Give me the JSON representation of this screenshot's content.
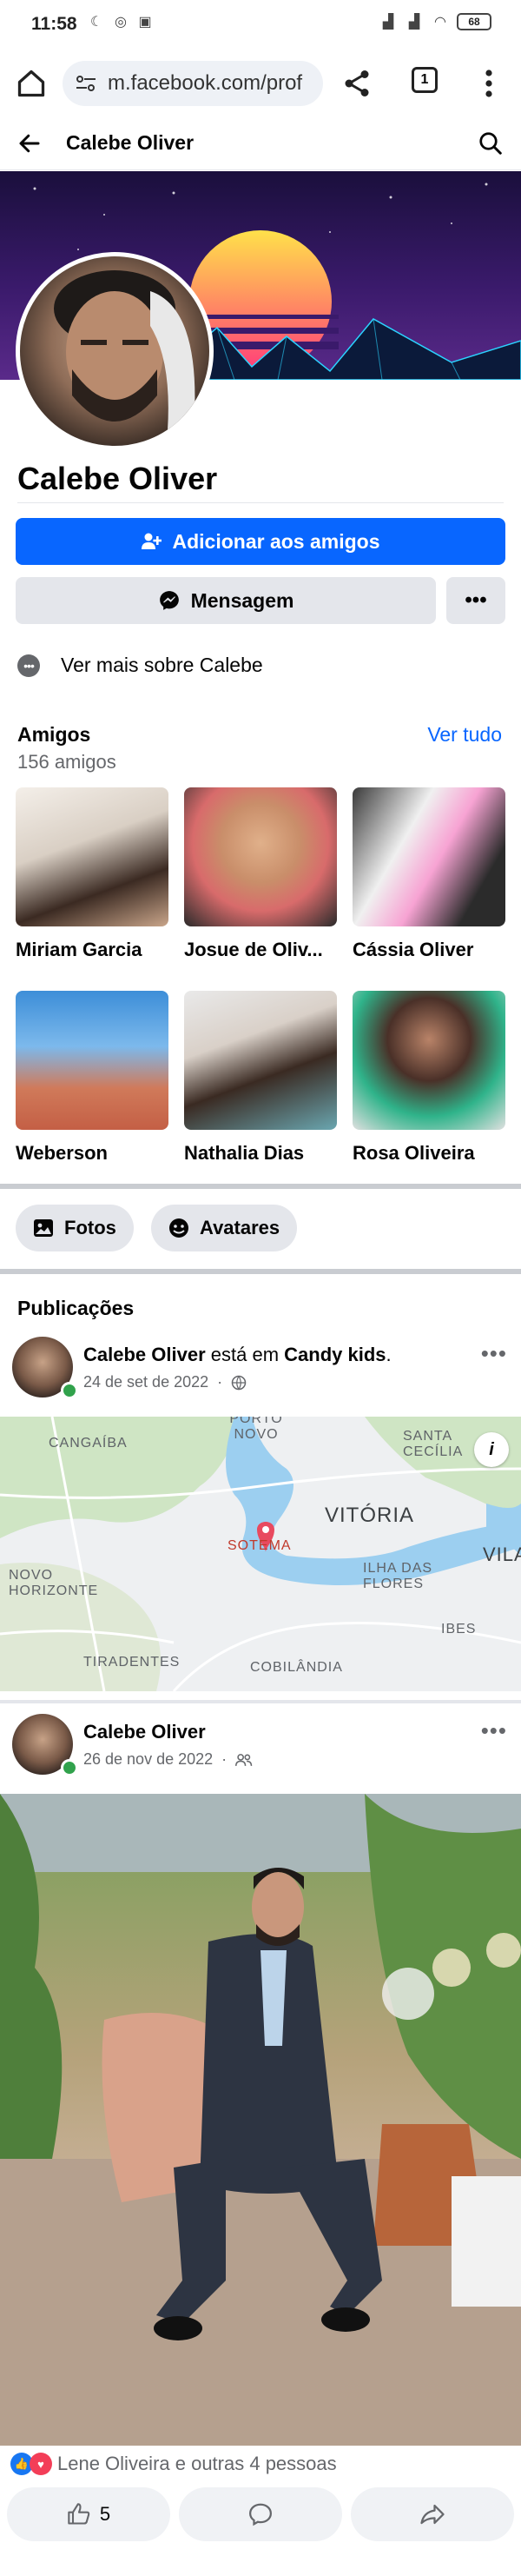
{
  "status_bar": {
    "time": "11:58",
    "battery": "68"
  },
  "browser": {
    "url": "m.facebook.com/prof",
    "tab_count": "1"
  },
  "header": {
    "title": "Calebe Oliver"
  },
  "profile": {
    "name": "Calebe Oliver",
    "add_friend_label": "Adicionar aos amigos",
    "message_label": "Mensagem",
    "more_label": "•••",
    "see_more_label": "Ver mais sobre Calebe"
  },
  "friends": {
    "title": "Amigos",
    "count": "156 amigos",
    "see_all": "Ver tudo",
    "items": [
      {
        "name": "Miriam Garcia"
      },
      {
        "name": "Josue de Oliv..."
      },
      {
        "name": "Cássia Oliver"
      },
      {
        "name": "Weberson"
      },
      {
        "name": "Nathalia Dias"
      },
      {
        "name": "Rosa Oliveira"
      }
    ]
  },
  "tabs": {
    "photos": "Fotos",
    "avatars": "Avatares"
  },
  "publications": {
    "title": "Publicações",
    "post1": {
      "author": "Calebe Oliver",
      "verb": "está em",
      "place": "Candy kids",
      "date": "24 de set de 2022"
    },
    "post2": {
      "author": "Calebe Oliver",
      "date": "26 de nov de 2022",
      "reactions_text": "Lene Oliveira e outras 4 pessoas",
      "like_count": "5"
    }
  },
  "map": {
    "labels": [
      "CANGAÍBA",
      "PORTO NOVO",
      "SANTA CECÍLIA",
      "VITÓRIA",
      "VILA",
      "NOVO HORIZONTE",
      "SOTEMA",
      "ILHA DAS FLORES",
      "IBES",
      "TIRADENTES",
      "COBILÂNDIA"
    ]
  },
  "colors": {
    "primary": "#0866ff",
    "secondary_bg": "#e4e6eb",
    "muted_text": "#65676b",
    "online": "#31a24c"
  }
}
